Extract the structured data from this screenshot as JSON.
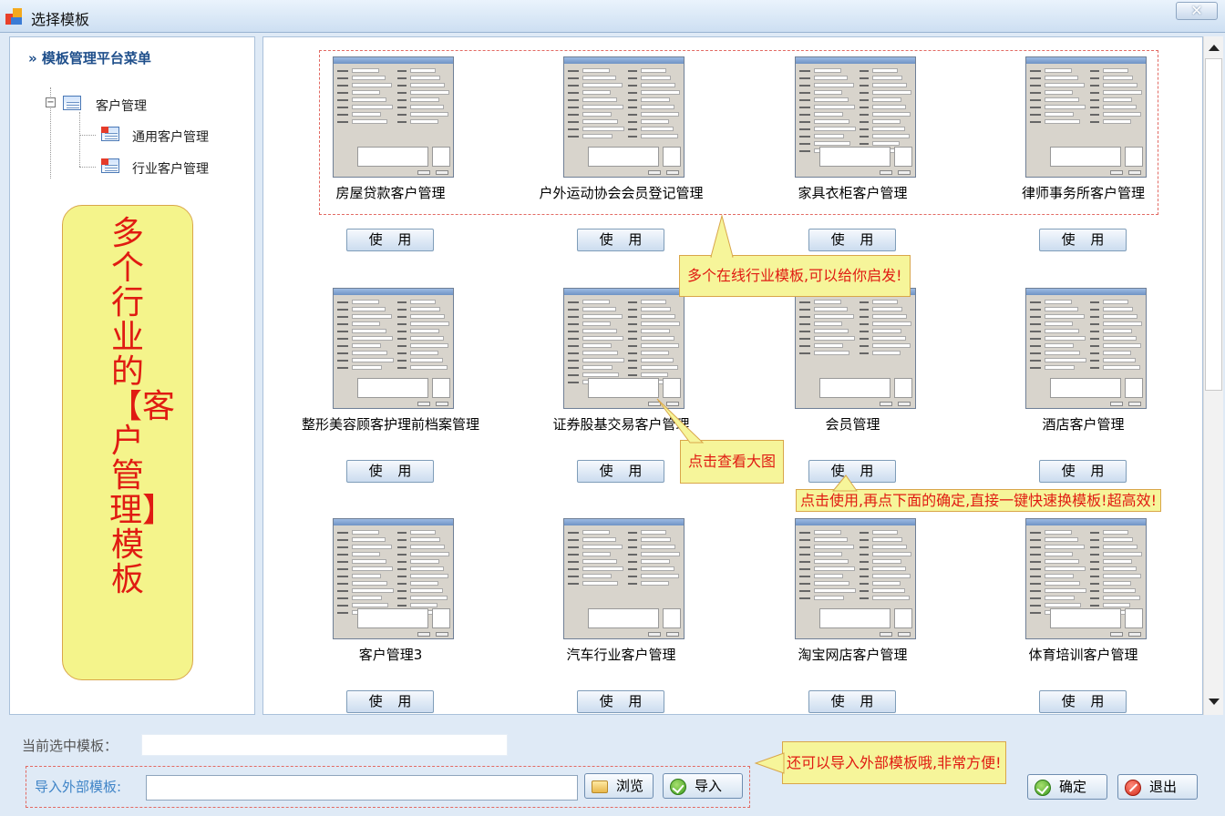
{
  "window": {
    "title": "选择模板",
    "close_glyph": "✕"
  },
  "sidebar": {
    "title": "» 模板管理平台菜单",
    "tree": {
      "root_label": "客户管理",
      "toggle": "−",
      "children": [
        "通用客户管理",
        "行业客户管理"
      ]
    },
    "promo_text": "多个行业的【客户管理】模板"
  },
  "templates": [
    {
      "name": "房屋贷款客户管理",
      "button": "使 用"
    },
    {
      "name": "户外运动协会会员登记管理",
      "button": "使 用"
    },
    {
      "name": "家具衣柜客户管理",
      "button": "使 用"
    },
    {
      "name": "律师事务所客户管理",
      "button": "使 用"
    },
    {
      "name": "整形美容顾客护理前档案管理",
      "button": "使 用"
    },
    {
      "name": "证券股基交易客户管理",
      "button": "使 用"
    },
    {
      "name": "会员管理",
      "button": "使 用"
    },
    {
      "name": "酒店客户管理",
      "button": "使 用"
    },
    {
      "name": "客户管理3",
      "button": "使 用"
    },
    {
      "name": "汽车行业客户管理",
      "button": "使 用"
    },
    {
      "name": "淘宝网店客户管理",
      "button": "使 用"
    },
    {
      "name": "体育培训客户管理",
      "button": "使 用"
    }
  ],
  "callouts": {
    "industry": "多个在线行业模板,可以给你启发!",
    "view_large": "点击查看大图",
    "use_hint": "点击使用,再点下面的确定,直接一键快速换模板!超高效!",
    "import_hint": "还可以导入外部模板哦,非常方便!"
  },
  "bottom": {
    "current_label": "当前选中模板：",
    "current_value": "",
    "import_label": "导入外部模板:",
    "import_value": "",
    "browse_label": "浏览",
    "import_button": "导入",
    "ok_button": "确定",
    "exit_button": "退出"
  },
  "colors": {
    "accent_red": "#e01b12",
    "callout_bg": "#f6f59a",
    "panel_bg": "#dfeaf6",
    "title_blue": "#1f4f8b"
  },
  "icons": {
    "app": "app-window-icon",
    "tree_root": "table-icon",
    "tree_child": "grid-icon",
    "browse": "folder-icon",
    "ok": "check-circle-icon",
    "exit": "cancel-circle-icon"
  }
}
